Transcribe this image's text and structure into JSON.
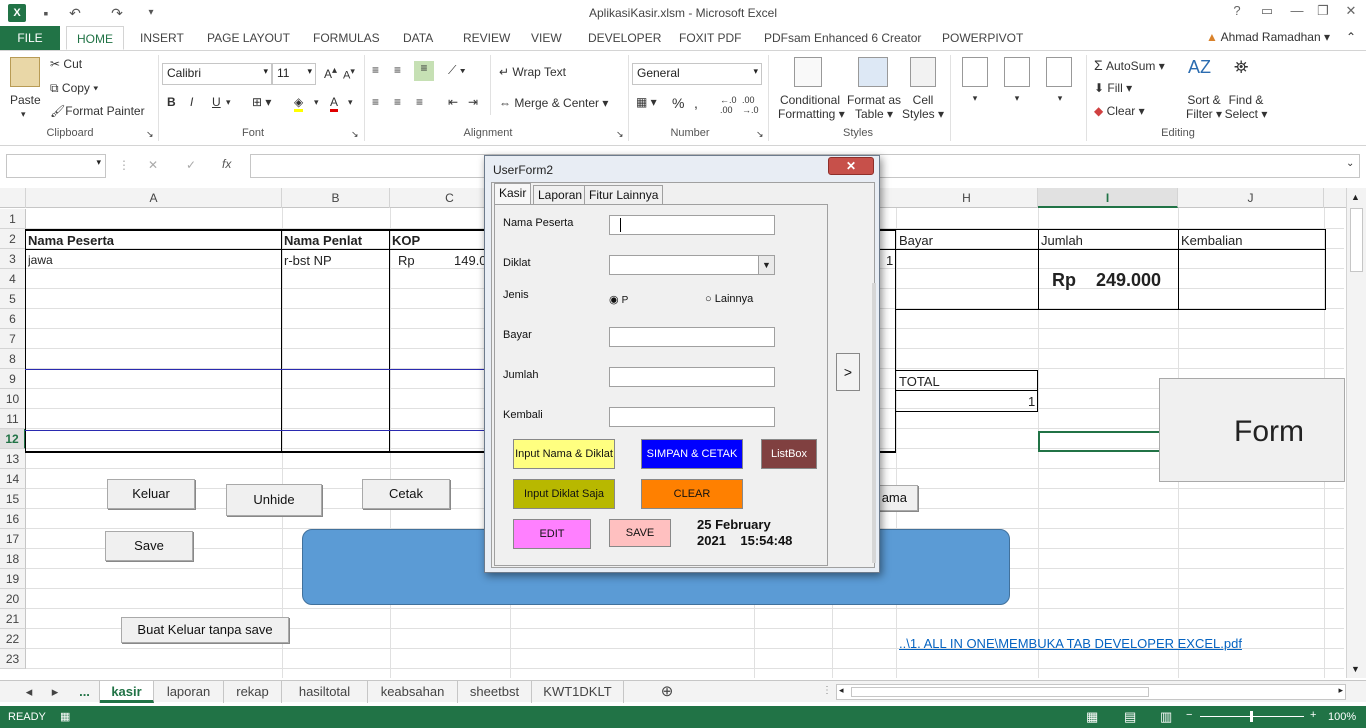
{
  "window": {
    "title": "AplikasiKasir.xlsm - Microsoft Excel",
    "help": "?"
  },
  "ribbon_tabs": {
    "file": "FILE",
    "home": "HOME",
    "insert": "INSERT",
    "page_layout": "PAGE LAYOUT",
    "formulas": "FORMULAS",
    "data": "DATA",
    "review": "REVIEW",
    "view": "VIEW",
    "developer": "DEVELOPER",
    "foxit": "FOXIT PDF",
    "pdfsam": "PDFsam Enhanced 6 Creator",
    "powerpivot": "POWERPIVOT"
  },
  "user": {
    "name": "Ahmad Ramadhan"
  },
  "clipboard": {
    "paste": "Paste",
    "cut": "Cut",
    "copy": "Copy",
    "format_painter": "Format Painter",
    "label": "Clipboard"
  },
  "font": {
    "name": "Calibri",
    "size": "11",
    "label": "Font",
    "bold": "B",
    "italic": "I",
    "underline": "U"
  },
  "alignment": {
    "wrap": "Wrap Text",
    "merge": "Merge & Center",
    "label": "Alignment"
  },
  "number": {
    "format": "General",
    "percent": "%",
    "comma": ",",
    "label": "Number"
  },
  "styles": {
    "conditional": "Conditional",
    "conditional2": "Formatting",
    "format_as": "Format as",
    "format_as2": "Table",
    "cell": "Cell",
    "cell2": "Styles",
    "label": "Styles"
  },
  "cells": {
    "a2": "Nama Peserta",
    "b2": "Nama Penlat",
    "c2": "KOP",
    "a3": "jawa",
    "b3": "r-bst NP",
    "c3_rp": "Rp",
    "c3_val": "149.0",
    "g3": "1",
    "h2": "Bayar",
    "i2": "Jumlah",
    "j2": "Kembalian",
    "i3_rp": "Rp",
    "i3_val": "249.000",
    "h9": "TOTAL",
    "h10": "1",
    "link": "..\\1. ALL IN ONE\\MEMBUKA TAB DEVELOPER EXCEL.pdf",
    "form_label": "Form",
    "ama": "ama"
  },
  "editing": {
    "autosum": "AutoSum",
    "fill": "Fill",
    "clear": "Clear",
    "sort": "Sort &",
    "sort2": "Filter",
    "find": "Find &",
    "find2": "Select",
    "label": "Editing"
  },
  "formula_bar": {
    "name_box": "",
    "fx": "fx",
    "x": "✕",
    "check": "✓"
  },
  "columns": [
    "A",
    "B",
    "C",
    "H",
    "I",
    "J"
  ],
  "rows": [
    "1",
    "2",
    "3",
    "4",
    "5",
    "6",
    "7",
    "8",
    "9",
    "10",
    "11",
    "12",
    "13",
    "14",
    "15",
    "16",
    "17",
    "18",
    "19",
    "20",
    "21",
    "22",
    "23"
  ],
  "sheet_buttons": {
    "keluar": "Keluar",
    "unhide": "Unhide",
    "cetak": "Cetak",
    "save": "Save",
    "keluar_nosave": "Buat Keluar tanpa save"
  },
  "sheet_tabs": [
    "...",
    "kasir",
    "laporan",
    "rekap",
    "hasiltotal",
    "keabsahan",
    "sheetbst",
    "KWT1DKLT"
  ],
  "status": {
    "ready": "READY",
    "zoom": "100%"
  },
  "userform": {
    "title": "UserForm2",
    "close": "✕",
    "tabs": [
      "Kasir",
      "Laporan",
      "Fitur Lainnya"
    ],
    "labels": {
      "nama": "Nama Peserta",
      "diklat": "Diklat",
      "jenis": "Jenis",
      "bayar": "Bayar",
      "jumlah": "Jumlah",
      "kembali": "Kembali"
    },
    "radio_p": "P",
    "radio_lain": "Lainnya",
    "next": ">",
    "buttons": {
      "input_nama": "Input Nama & Diklat",
      "simpan": "SIMPAN & CETAK",
      "listbox": "ListBox",
      "input_diklat": "Input Diklat Saja",
      "clear": "CLEAR",
      "edit": "EDIT",
      "save": "SAVE"
    },
    "date": "25 February",
    "datetime": "2021    15:54:48"
  }
}
